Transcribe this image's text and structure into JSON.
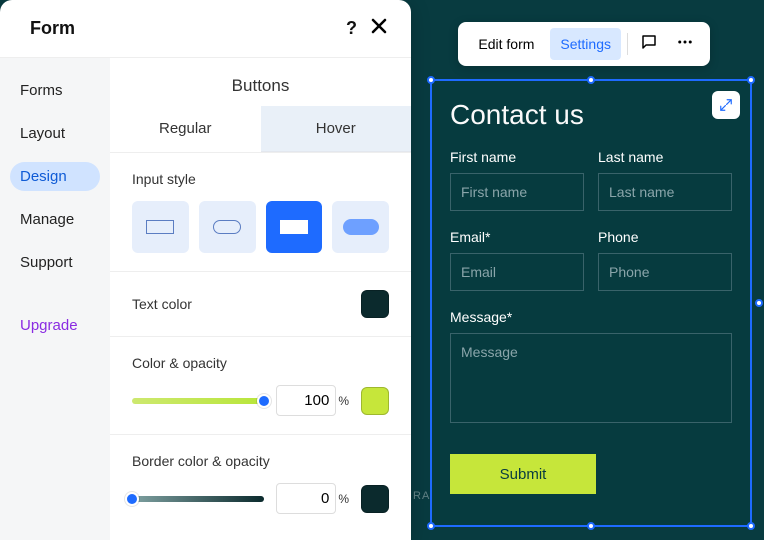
{
  "panel": {
    "title": "Form",
    "sidebar": {
      "items": [
        {
          "label": "Forms"
        },
        {
          "label": "Layout"
        },
        {
          "label": "Design"
        },
        {
          "label": "Manage"
        },
        {
          "label": "Support"
        }
      ],
      "upgrade": "Upgrade",
      "activeIndex": 2
    },
    "section_title": "Buttons",
    "tabs": [
      {
        "label": "Regular"
      },
      {
        "label": "Hover"
      }
    ],
    "activeTabIndex": 0,
    "input_style_label": "Input style",
    "input_style_selected": 2,
    "text_color": {
      "label": "Text color",
      "value": "#0b2a2d"
    },
    "color_opacity": {
      "label": "Color & opacity",
      "percent": "100",
      "unit": "%",
      "swatch": "#c6e63a"
    },
    "border_color_opacity": {
      "label": "Border color & opacity",
      "percent": "0",
      "unit": "%",
      "swatch": "#0b2a2d"
    }
  },
  "toolbar": {
    "edit_label": "Edit form",
    "settings_label": "Settings"
  },
  "form_preview": {
    "title": "Contact us",
    "fields": {
      "first_name": {
        "label": "First name",
        "placeholder": "First name"
      },
      "last_name": {
        "label": "Last name",
        "placeholder": "Last name"
      },
      "email": {
        "label": "Email*",
        "placeholder": "Email"
      },
      "phone": {
        "label": "Phone",
        "placeholder": "Phone"
      },
      "message": {
        "label": "Message*",
        "placeholder": "Message"
      }
    },
    "submit_label": "Submit"
  },
  "brand_tag": "RA",
  "colors": {
    "accent": "#1e6bff",
    "lime": "#c6e63a",
    "darkteal": "#063b3f"
  }
}
